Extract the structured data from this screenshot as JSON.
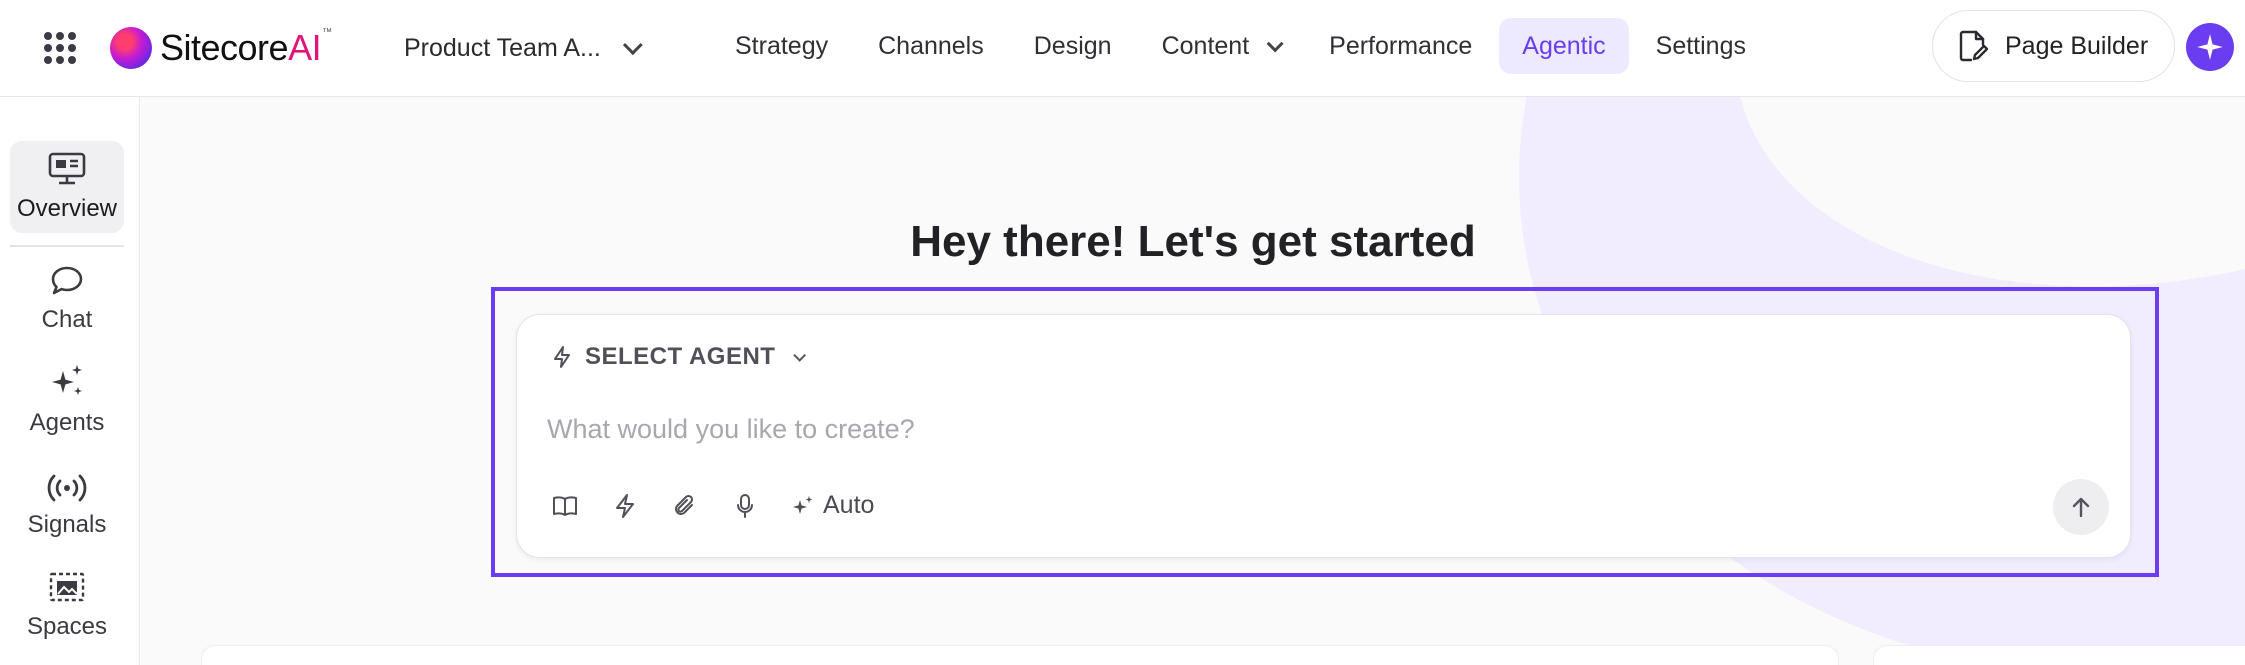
{
  "brand": {
    "name_prefix": "Sitecore",
    "name_suffix": "AI",
    "trademark": "™"
  },
  "site_switcher": {
    "label": "Product Team A..."
  },
  "nav": {
    "items": [
      {
        "label": "Strategy"
      },
      {
        "label": "Channels"
      },
      {
        "label": "Design"
      },
      {
        "label": "Content"
      },
      {
        "label": "Performance"
      },
      {
        "label": "Agentic"
      },
      {
        "label": "Settings"
      }
    ],
    "active": "Agentic"
  },
  "page_builder": {
    "label": "Page Builder"
  },
  "rail": {
    "items": [
      {
        "label": "Overview",
        "icon": "monitor-dashboard-icon"
      },
      {
        "label": "Chat",
        "icon": "chat-bubble-icon"
      },
      {
        "label": "Agents",
        "icon": "sparkles-icon"
      },
      {
        "label": "Signals",
        "icon": "broadcast-icon"
      },
      {
        "label": "Spaces",
        "icon": "image-frame-icon"
      }
    ],
    "active": "Overview"
  },
  "main": {
    "heading": "Hey there! Let's get started",
    "prompt": {
      "agent_select_label": "SELECT AGENT",
      "placeholder": "What would you like to create?",
      "mode_label": "Auto"
    }
  },
  "colors": {
    "accent": "#6a3df0",
    "accent_soft": "#ede9fe",
    "brand_ai": "#e0157a"
  }
}
